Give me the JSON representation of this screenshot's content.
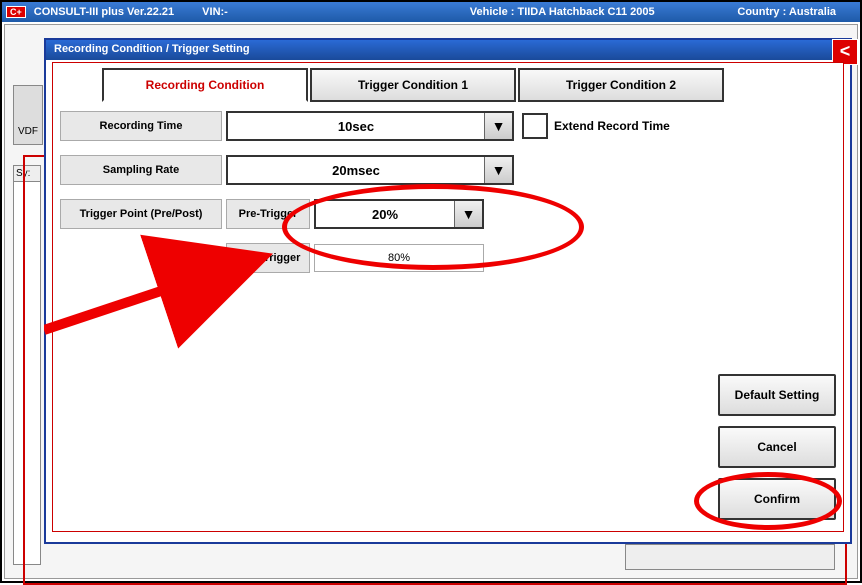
{
  "topbar": {
    "badge": "C+",
    "app": "CONSULT-III plus  Ver.22.21",
    "vin_label": "VIN:-",
    "vehicle": "Vehicle : TIIDA Hatchback C11 2005",
    "country": "Country : Australia"
  },
  "bg": {
    "vdr": "VDF",
    "sys": "Sy:"
  },
  "modal": {
    "title": "Recording Condition / Trigger Setting",
    "close": "<",
    "tabs": {
      "recording": "Recording Condition",
      "tc1": "Trigger Condition 1",
      "tc2": "Trigger Condition 2"
    },
    "form": {
      "recording_time_label": "Recording Time",
      "recording_time_value": "10sec",
      "extend_label": "Extend Record Time",
      "sampling_label": "Sampling Rate",
      "sampling_value": "20msec",
      "trigger_point_label": "Trigger Point (Pre/Post)",
      "pre_label": "Pre-Trigger",
      "pre_value": "20%",
      "post_label": "Post-Trigger",
      "post_value": "80%"
    },
    "buttons": {
      "default": "Default Setting",
      "cancel": "Cancel",
      "confirm": "Confirm"
    }
  }
}
